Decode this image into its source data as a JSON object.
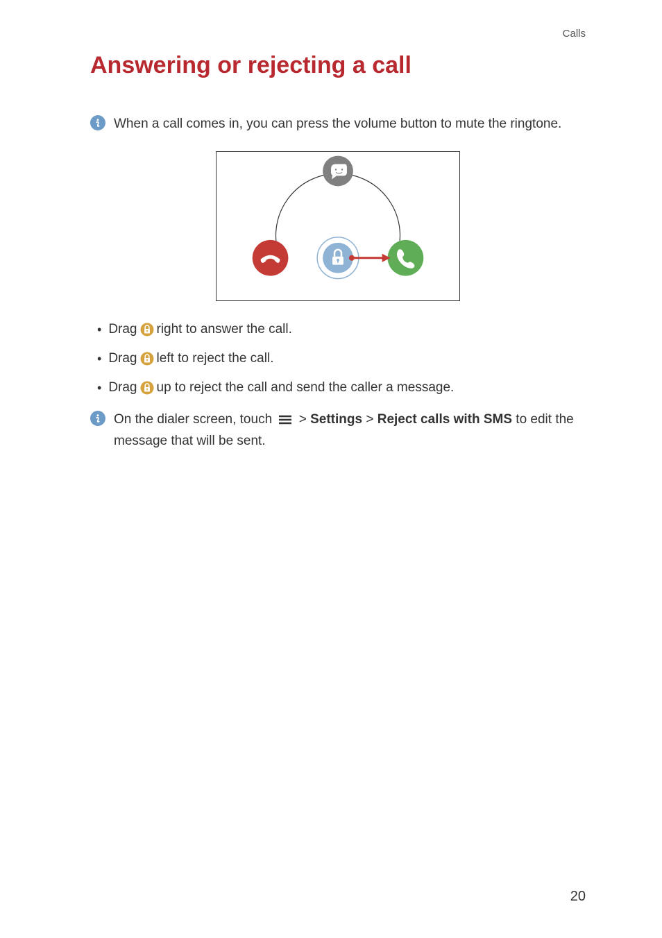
{
  "header": {
    "section": "Calls"
  },
  "title": "Answering or rejecting a call",
  "tip1": "When a call comes in, you can press the volume button to mute the ringtone.",
  "bullets": {
    "b1_pre": "Drag",
    "b1_post": "right to answer the call.",
    "b2_pre": "Drag",
    "b2_post": "left to reject the call.",
    "b3_pre": "Drag",
    "b3_post": "up to reject the call and send the caller a message."
  },
  "tip2": {
    "pre": "On the dialer screen, touch",
    "gt1": ">",
    "settings": "Settings",
    "gt2": ">",
    "reject": "Reject calls with SMS",
    "post": "to edit the message that will be sent."
  },
  "page_number": "20"
}
